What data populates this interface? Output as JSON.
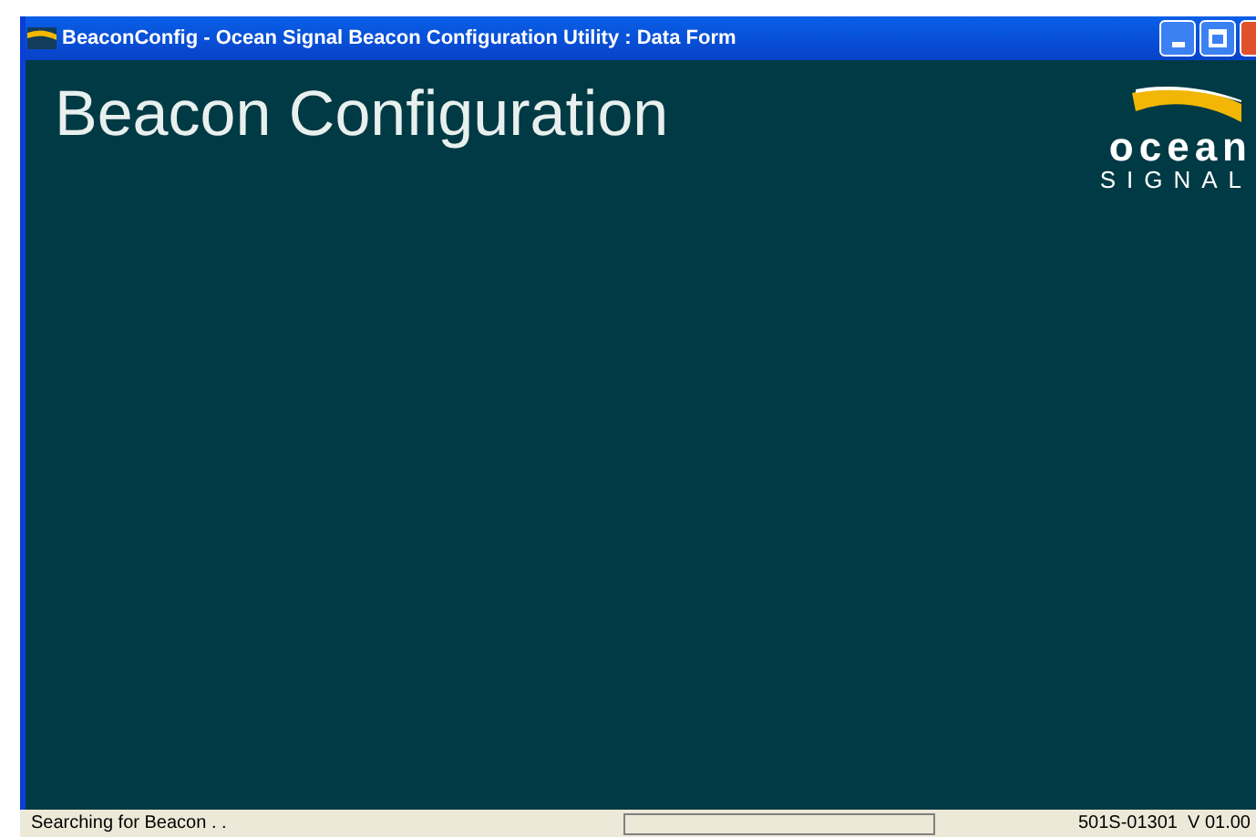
{
  "window": {
    "title": "BeaconConfig - Ocean Signal Beacon Configuration Utility : Data Form"
  },
  "heading": "Beacon Configuration",
  "logo": {
    "word": "ocean",
    "subword": "SIGNAL"
  },
  "status_bar": {
    "message": "Searching for Beacon . .",
    "progress": {
      "level": 0
    },
    "version": "501S-01301  V 01.00"
  }
}
